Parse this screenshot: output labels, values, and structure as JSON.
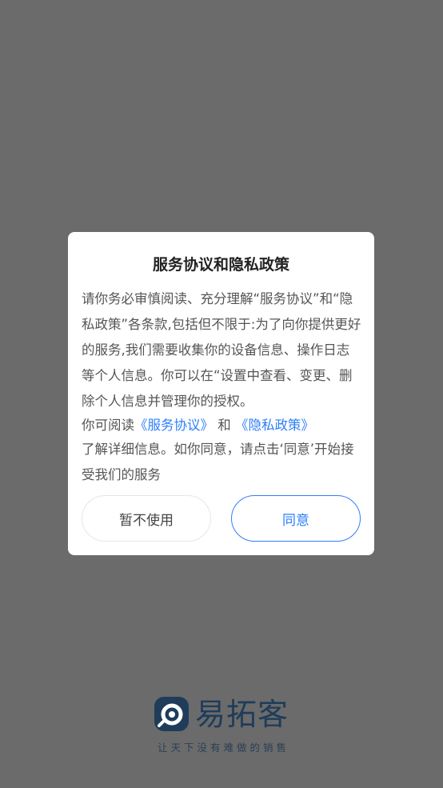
{
  "dialog": {
    "title": "服务协议和隐私政策",
    "body": "请你务必审慎阅读、充分理解“服务协议”和“隐私政策”各条款,包括但不限于:为了向你提供更好的服务,我们需要收集你的设备信息、操作日志等个人信息。你可以在“设置中查看、变更、删除个人信息并管理你的授权。",
    "read_prefix": "你可阅读",
    "service_link": "《服务协议》",
    "and_text": "和",
    "privacy_link": "《隐私政策》",
    "tail": "了解详细信息。如你同意，请点击‘同意’开始接受我们的服务",
    "decline_label": "暂不使用",
    "agree_label": "同意"
  },
  "brand": {
    "name": "易拓客",
    "slogan": "让天下没有难做的销售",
    "logo_icon": "yituoke-logo-icon",
    "color": "#1f3c5a"
  },
  "colors": {
    "overlay": "#6b6b6b",
    "accent": "#2d7ff9",
    "dialog_bg": "#ffffff"
  }
}
